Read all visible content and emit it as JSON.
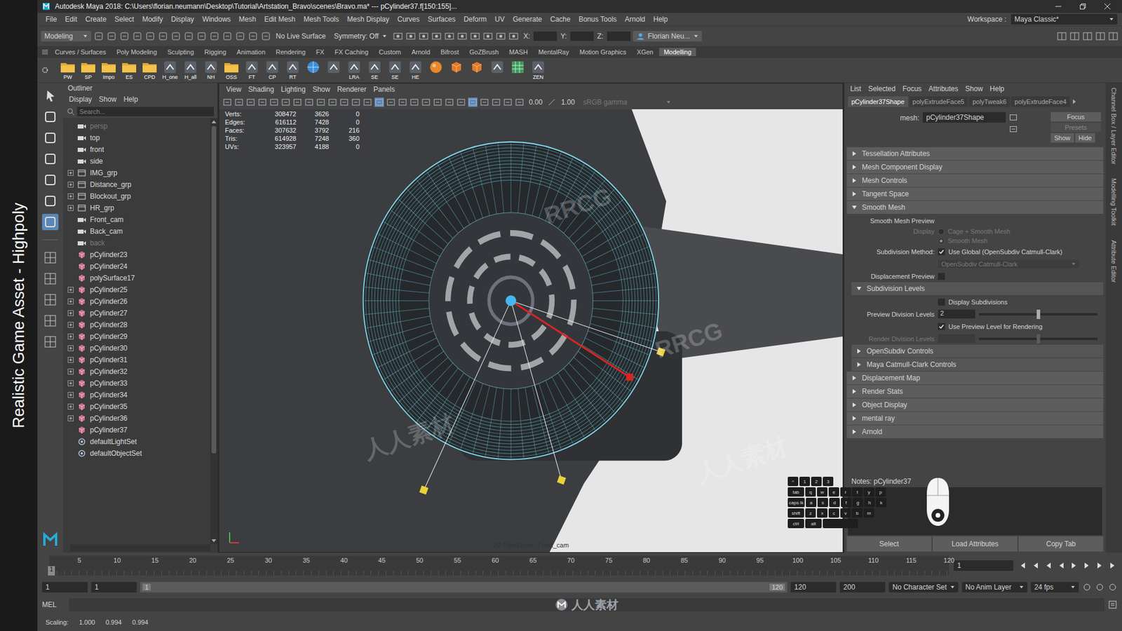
{
  "side_caption": "Realistic Game Asset - Highpoly",
  "window": {
    "title": "Autodesk Maya 2018: C:\\Users\\florian.neumann\\Desktop\\Tutorial\\Artstation_Bravo\\scenes\\Bravo.ma*  ---  pCylinder37.f[150:155]..."
  },
  "menu_bar": {
    "items": [
      "File",
      "Edit",
      "Create",
      "Select",
      "Modify",
      "Display",
      "Windows",
      "Mesh",
      "Edit Mesh",
      "Mesh Tools",
      "Mesh Display",
      "Curves",
      "Surfaces",
      "Deform",
      "UV",
      "Generate",
      "Cache",
      "Bonus Tools",
      "Arnold",
      "Help"
    ],
    "workspace_label": "Workspace :",
    "workspace_value": "Maya Classic*"
  },
  "status_line": {
    "mode": "Modeling",
    "live_surface": "No Live Surface",
    "symmetry": "Symmetry: Off",
    "coords": [
      "X:",
      "Y:",
      "Z:"
    ],
    "user": "Florian Neu..."
  },
  "shelf": {
    "tabs": [
      {
        "label": "Curves / Surfaces",
        "selected": false
      },
      {
        "label": "Poly Modeling",
        "selected": false
      },
      {
        "label": "Sculpting",
        "selected": false
      },
      {
        "label": "Rigging",
        "selected": false
      },
      {
        "label": "Animation",
        "selected": false
      },
      {
        "label": "Rendering",
        "selected": false
      },
      {
        "label": "FX",
        "selected": false
      },
      {
        "label": "FX Caching",
        "selected": false
      },
      {
        "label": "Custom",
        "selected": false
      },
      {
        "label": "Arnold",
        "selected": false
      },
      {
        "label": "Bifrost",
        "selected": false
      },
      {
        "label": "GoZBrush",
        "selected": false
      },
      {
        "label": "MASH",
        "selected": false
      },
      {
        "label": "MentalRay",
        "selected": false
      },
      {
        "label": "Motion Graphics",
        "selected": false
      },
      {
        "label": "XGen",
        "selected": false
      },
      {
        "label": "Modelling",
        "selected": true
      }
    ],
    "buttons": [
      {
        "label": "PW",
        "kind": "folder"
      },
      {
        "label": "SP",
        "kind": "folder"
      },
      {
        "label": "Impo",
        "kind": "folder"
      },
      {
        "label": "ES",
        "kind": "folder"
      },
      {
        "label": "CPD",
        "kind": "folder"
      },
      {
        "label": "H_one",
        "kind": "tool"
      },
      {
        "label": "H_all",
        "kind": "tool"
      },
      {
        "label": "NH",
        "kind": "tool"
      },
      {
        "label": "OSS",
        "kind": "folder"
      },
      {
        "label": "FT",
        "kind": "tool"
      },
      {
        "label": "CP",
        "kind": "tool"
      },
      {
        "label": "RT",
        "kind": "tool"
      },
      {
        "label": "",
        "kind": "globe"
      },
      {
        "label": "",
        "kind": "tool"
      },
      {
        "label": "LRA",
        "kind": "tool"
      },
      {
        "label": "SE",
        "kind": "tool"
      },
      {
        "label": "SE",
        "kind": "tool"
      },
      {
        "label": "HE",
        "kind": "tool"
      },
      {
        "label": "",
        "kind": "sphere"
      },
      {
        "label": "",
        "kind": "cube"
      },
      {
        "label": "",
        "kind": "cube"
      },
      {
        "label": "",
        "kind": "tool"
      },
      {
        "label": "",
        "kind": "grid"
      },
      {
        "label": "ZEN",
        "kind": "tool"
      }
    ]
  },
  "outliner": {
    "title": "Outliner",
    "menu": [
      "Display",
      "Show",
      "Help"
    ],
    "search_placeholder": "Search...",
    "items": [
      {
        "label": "persp",
        "kind": "camera",
        "expandable": false,
        "dimmed": true
      },
      {
        "label": "top",
        "kind": "camera",
        "expandable": false,
        "dimmed": false
      },
      {
        "label": "front",
        "kind": "camera",
        "expandable": false,
        "dimmed": false
      },
      {
        "label": "side",
        "kind": "camera",
        "expandable": false,
        "dimmed": false
      },
      {
        "label": "IMG_grp",
        "kind": "group",
        "expandable": true,
        "dimmed": false
      },
      {
        "label": "Distance_grp",
        "kind": "group",
        "expandable": true,
        "dimmed": false
      },
      {
        "label": "Blockout_grp",
        "kind": "group",
        "expandable": true,
        "dimmed": false
      },
      {
        "label": "HR_grp",
        "kind": "group",
        "expandable": true,
        "dimmed": false
      },
      {
        "label": "Front_cam",
        "kind": "camera",
        "expandable": false,
        "dimmed": false
      },
      {
        "label": "Back_cam",
        "kind": "camera",
        "expandable": false,
        "dimmed": false
      },
      {
        "label": "back",
        "kind": "camera",
        "expandable": false,
        "dimmed": true
      },
      {
        "label": "pCylinder23",
        "kind": "mesh",
        "expandable": false,
        "dimmed": false
      },
      {
        "label": "pCylinder24",
        "kind": "mesh",
        "expandable": false,
        "dimmed": false
      },
      {
        "label": "polySurface17",
        "kind": "mesh",
        "expandable": false,
        "dimmed": false
      },
      {
        "label": "pCylinder25",
        "kind": "mesh",
        "expandable": true,
        "dimmed": false
      },
      {
        "label": "pCylinder26",
        "kind": "mesh",
        "expandable": true,
        "dimmed": false
      },
      {
        "label": "pCylinder27",
        "kind": "mesh",
        "expandable": true,
        "dimmed": false
      },
      {
        "label": "pCylinder28",
        "kind": "mesh",
        "expandable": true,
        "dimmed": false
      },
      {
        "label": "pCylinder29",
        "kind": "mesh",
        "expandable": true,
        "dimmed": false
      },
      {
        "label": "pCylinder30",
        "kind": "mesh",
        "expandable": true,
        "dimmed": false
      },
      {
        "label": "pCylinder31",
        "kind": "mesh",
        "expandable": true,
        "dimmed": false
      },
      {
        "label": "pCylinder32",
        "kind": "mesh",
        "expandable": true,
        "dimmed": false
      },
      {
        "label": "pCylinder33",
        "kind": "mesh",
        "expandable": true,
        "dimmed": false
      },
      {
        "label": "pCylinder34",
        "kind": "mesh",
        "expandable": true,
        "dimmed": false
      },
      {
        "label": "pCylinder35",
        "kind": "mesh",
        "expandable": true,
        "dimmed": false
      },
      {
        "label": "pCylinder36",
        "kind": "mesh",
        "expandable": true,
        "dimmed": false
      },
      {
        "label": "pCylinder37",
        "kind": "mesh",
        "expandable": false,
        "dimmed": false
      },
      {
        "label": "defaultLightSet",
        "kind": "set",
        "expandable": false,
        "dimmed": false
      },
      {
        "label": "defaultObjectSet",
        "kind": "set",
        "expandable": false,
        "dimmed": false
      }
    ]
  },
  "viewport": {
    "menu": [
      "View",
      "Shading",
      "Lighting",
      "Show",
      "Renderer",
      "Panels"
    ],
    "toolbar_values": [
      "0.00",
      "1.00"
    ],
    "color_space": "sRGB gamma",
    "hud": [
      {
        "label": "Verts:",
        "values": [
          "308472",
          "3626",
          "0"
        ]
      },
      {
        "label": "Edges:",
        "values": [
          "616112",
          "7428",
          "0"
        ]
      },
      {
        "label": "Faces:",
        "values": [
          "307632",
          "3792",
          "216"
        ]
      },
      {
        "label": "Tris:",
        "values": [
          "614928",
          "7248",
          "360"
        ]
      },
      {
        "label": "UVs:",
        "values": [
          "323957",
          "4188",
          "0"
        ]
      }
    ],
    "camera_label": "2D Pan/Zoom : Front_cam"
  },
  "watermarks": [
    "RRCG",
    "人人素材"
  ],
  "attribute_editor": {
    "menu": [
      "List",
      "Selected",
      "Focus",
      "Attributes",
      "Show",
      "Help"
    ],
    "tabs": [
      {
        "label": "pCylinder37Shape",
        "selected": true
      },
      {
        "label": "polyExtrudeFace5",
        "selected": false
      },
      {
        "label": "polyTweak6",
        "selected": false
      },
      {
        "label": "polyExtrudeFace4",
        "selected": false
      }
    ],
    "mesh_label": "mesh:",
    "mesh_value": "pCylinder37Shape",
    "side_buttons": [
      "Focus",
      "Presets",
      "Show",
      "Hide"
    ],
    "rows": [
      {
        "kind": "section",
        "label": "Tessellation Attributes",
        "expanded": false
      },
      {
        "kind": "section",
        "label": "Mesh Component Display",
        "expanded": false
      },
      {
        "kind": "section",
        "label": "Mesh Controls",
        "expanded": false
      },
      {
        "kind": "section",
        "label": "Tangent Space",
        "expanded": false
      },
      {
        "kind": "section",
        "label": "Smooth Mesh",
        "expanded": true
      },
      {
        "kind": "label",
        "label": "Smooth Mesh Preview"
      },
      {
        "kind": "radio",
        "label": "Display",
        "disabled": true,
        "options": [
          {
            "label": "Cage + Smooth Mesh",
            "selected": false
          },
          {
            "label": "Smooth Mesh",
            "selected": true
          }
        ]
      },
      {
        "kind": "check",
        "label": "Subdivision Method:",
        "text": "Use Global (OpenSubdiv Catmull-Clark)",
        "checked": true
      },
      {
        "kind": "dropdown",
        "value": "OpenSubdiv Catmull-Clark",
        "disabled": true
      },
      {
        "kind": "check",
        "label": "Displacement Preview",
        "text": "",
        "checked": false
      },
      {
        "kind": "subsection",
        "label": "Subdivision Levels",
        "expanded": true
      },
      {
        "kind": "check",
        "label": "",
        "text": "Display Subdivisions",
        "checked": false
      },
      {
        "kind": "slider",
        "label": "Preview Division Levels",
        "value": "2",
        "level": 0.5,
        "disabled": false
      },
      {
        "kind": "check",
        "label": "",
        "text": "Use Preview Level for Rendering",
        "checked": true
      },
      {
        "kind": "slider",
        "label": "Render Division Levels",
        "value": "",
        "level": 0.5,
        "disabled": true
      },
      {
        "kind": "subsection",
        "label": "OpenSubdiv Controls",
        "expanded": false
      },
      {
        "kind": "subsection",
        "label": "Maya Catmull-Clark Controls",
        "expanded": false
      },
      {
        "kind": "section",
        "label": "Displacement Map",
        "expanded": false
      },
      {
        "kind": "section",
        "label": "Render Stats",
        "expanded": false
      },
      {
        "kind": "section",
        "label": "Object Display",
        "expanded": false
      },
      {
        "kind": "section",
        "label": "mental ray",
        "expanded": false
      },
      {
        "kind": "section",
        "label": "Arnold",
        "expanded": false
      }
    ],
    "notes_label": "Notes: pCylinder37",
    "buttons": [
      "Select",
      "Load Attributes",
      "Copy Tab"
    ]
  },
  "keycast": {
    "rows": [
      [
        "^",
        "1",
        "2",
        "3"
      ],
      [
        "tab",
        "q",
        "w",
        "e",
        "r",
        "t",
        "y",
        "p"
      ],
      [
        "caps lk",
        "a",
        "s",
        "d",
        "f",
        "g",
        "h",
        "k"
      ],
      [
        "shift",
        "z",
        "x",
        "c",
        "v",
        "b",
        "m"
      ],
      [
        "ctrl",
        "alt",
        ""
      ]
    ]
  },
  "side_tabs": [
    "Channel Box / Layer Editor",
    "Modelling Toolkit",
    "Attribute Editor"
  ],
  "time_slider": {
    "ticks": [
      "5",
      "10",
      "15",
      "20",
      "25",
      "30",
      "35",
      "40",
      "45",
      "50",
      "55",
      "60",
      "65",
      "70",
      "75",
      "80",
      "85",
      "90",
      "95",
      "100",
      "105",
      "110",
      "115",
      "120"
    ],
    "marker_label": "1",
    "current_frame": "1"
  },
  "range_slider": {
    "start": "1",
    "inner_start": "1",
    "bar_start": "1",
    "bar_end": "120",
    "inner_end": "120",
    "end": "200",
    "character_set": "No Character Set",
    "anim_layer": "No Anim Layer",
    "fps": "24 fps"
  },
  "command_line": {
    "language": "MEL"
  },
  "help_line": {
    "label": "Scaling:",
    "values": [
      "1.000",
      "0.994",
      "0.994"
    ]
  }
}
